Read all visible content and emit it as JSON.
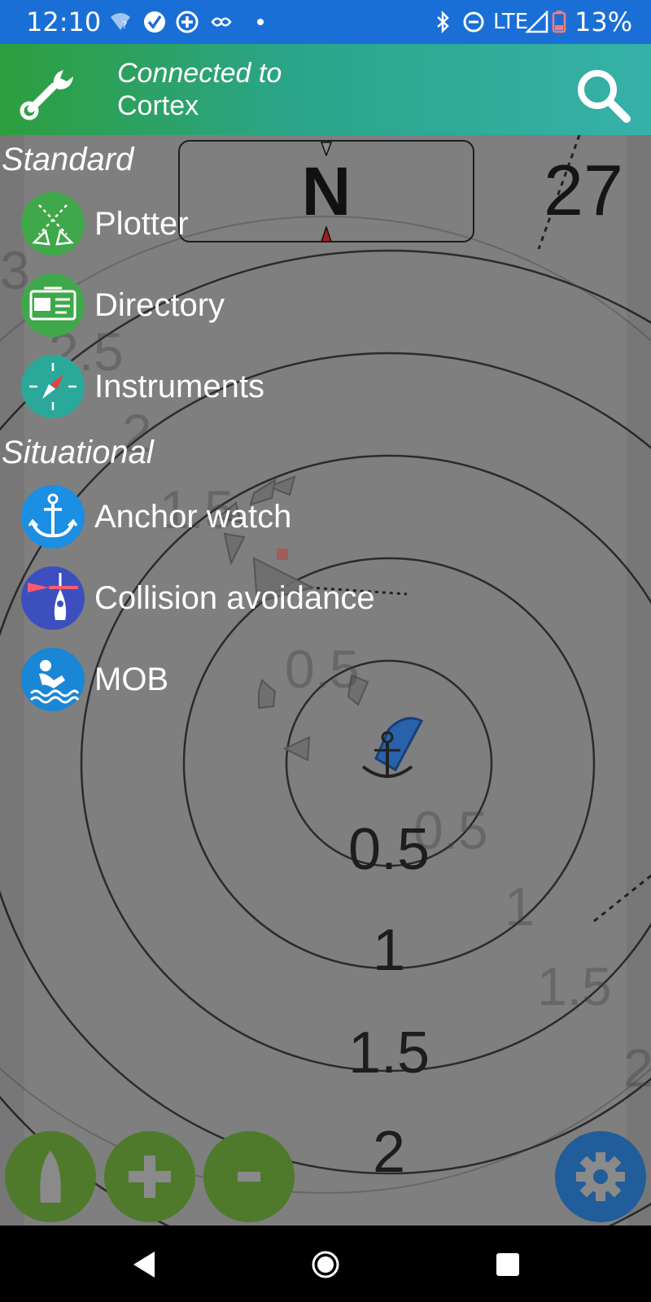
{
  "status_bar": {
    "time": "12:10",
    "network": "LTE",
    "battery": "13%",
    "icons": [
      "wifi-question-icon",
      "check-circle-icon",
      "plus-circle-icon",
      "handshake-icon",
      "dot-icon",
      "bluetooth-icon",
      "do-not-disturb-icon",
      "signal-icon",
      "battery-low-icon"
    ]
  },
  "app_bar": {
    "status_line1": "Connected to",
    "status_line2": "Cortex",
    "color_start": "#2e9e3e",
    "color_end": "#36b1a8"
  },
  "map": {
    "heading_label": "N",
    "speed_value": "27",
    "ring_labels": [
      "0.5",
      "1",
      "1.5",
      "2"
    ]
  },
  "menu": {
    "sections": [
      {
        "title": "Standard",
        "items": [
          {
            "label": "Plotter",
            "icon": "plotter-icon",
            "color": "#3fa84a"
          },
          {
            "label": "Directory",
            "icon": "directory-card-icon",
            "color": "#3fa84a"
          },
          {
            "label": "Instruments",
            "icon": "compass-icon",
            "color": "#2aa89a"
          }
        ]
      },
      {
        "title": "Situational",
        "items": [
          {
            "label": "Anchor watch",
            "icon": "anchor-icon",
            "color": "#1a8fe3"
          },
          {
            "label": "Collision avoidance",
            "icon": "collision-buoy-icon",
            "color": "#3d4fbf"
          },
          {
            "label": "MOB",
            "icon": "man-overboard-icon",
            "color": "#1a86d6"
          }
        ]
      }
    ]
  },
  "bottom_buttons": {
    "left": [
      "boat-icon",
      "zoom-in-icon",
      "zoom-out-icon"
    ],
    "right": "settings-gear-icon",
    "left_color": "#4f7a2c",
    "right_color": "#205d9a"
  }
}
